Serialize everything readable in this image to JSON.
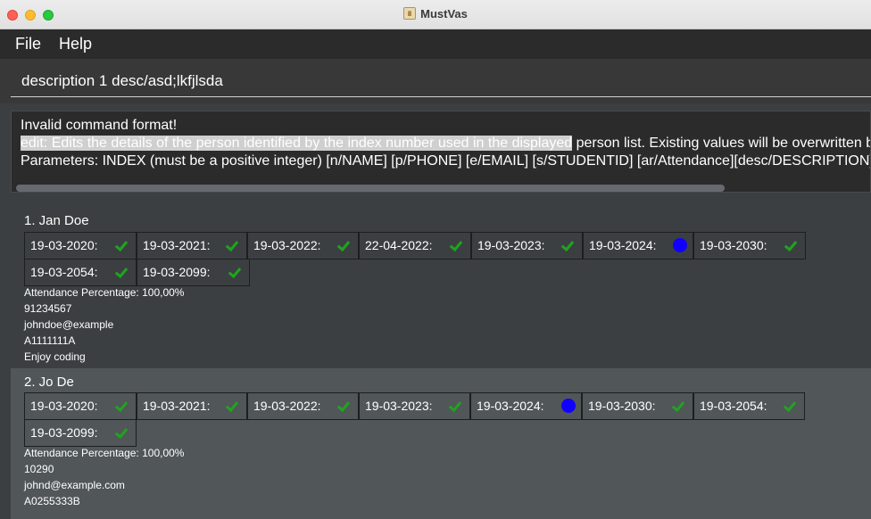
{
  "window": {
    "title": "MustVas"
  },
  "menu": {
    "file": "File",
    "help": "Help"
  },
  "command": {
    "value": "description 1 desc/asd;lkfjlsda"
  },
  "result": {
    "line1": "Invalid command format!",
    "line2_highlight": "edit: Edits the details of the person identified by the index number used in the displayed",
    "line2_rest": " person list. Existing values will be overwritten by the input values.",
    "line3": "Parameters: INDEX (must be a positive integer) [n/NAME] [p/PHONE] [e/EMAIL] [s/STUDENTID] [ar/Attendance][desc/DESCRIPTION]"
  },
  "persons": [
    {
      "name": "1.  Jan Doe",
      "attendance": [
        {
          "date": "19-03-2020:",
          "status": "present"
        },
        {
          "date": "19-03-2021:",
          "status": "present"
        },
        {
          "date": "19-03-2022:",
          "status": "present"
        },
        {
          "date": "22-04-2022:",
          "status": "present"
        },
        {
          "date": "19-03-2023:",
          "status": "present"
        },
        {
          "date": "19-03-2024:",
          "status": "unmarked"
        },
        {
          "date": "19-03-2030:",
          "status": "present"
        },
        {
          "date": "19-03-2054:",
          "status": "present"
        },
        {
          "date": "19-03-2099:",
          "status": "present"
        }
      ],
      "percentage": "Attendance Percentage: 100,00%",
      "phone": "91234567",
      "email": "johndoe@example",
      "student_id": "A1111111A",
      "description": "Enjoy coding"
    },
    {
      "name": "2.  Jo De",
      "attendance": [
        {
          "date": "19-03-2020:",
          "status": "present"
        },
        {
          "date": "19-03-2021:",
          "status": "present"
        },
        {
          "date": "19-03-2022:",
          "status": "present"
        },
        {
          "date": "19-03-2023:",
          "status": "present"
        },
        {
          "date": "19-03-2024:",
          "status": "unmarked"
        },
        {
          "date": "19-03-2030:",
          "status": "present"
        },
        {
          "date": "19-03-2054:",
          "status": "present"
        },
        {
          "date": "19-03-2099:",
          "status": "present"
        }
      ],
      "percentage": "Attendance Percentage: 100,00%",
      "phone": "10290",
      "email": "johnd@example.com",
      "student_id": "A0255333B"
    }
  ],
  "icons": {
    "present": "green-check-icon",
    "unmarked": "blue-dot-icon"
  },
  "colors": {
    "present": "#1fa41f",
    "unmarked": "#1100ff",
    "background": "#3c3f41",
    "selected_card": "#515658"
  }
}
